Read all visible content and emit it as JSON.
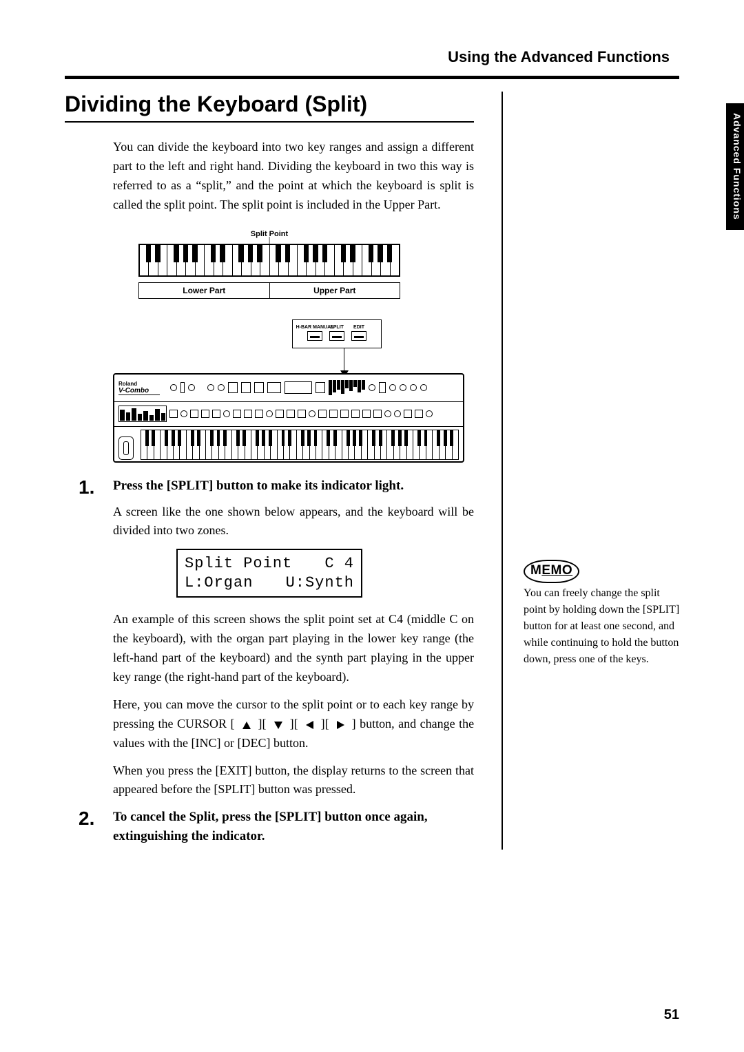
{
  "header": {
    "chapter": "Using the Advanced Functions"
  },
  "sideTab": "Advanced Functions",
  "section": {
    "title": "Dividing the Keyboard (Split)",
    "intro": "You can divide the keyboard into two key ranges and assign a different part to the left and right hand. Dividing the keyboard in two this way is referred to as a “split,” and the point at which the keyboard is split is called the split point. The split point is included in the Upper Part."
  },
  "diagram": {
    "splitLabel": "Split Point",
    "lower": "Lower Part",
    "upper": "Upper Part"
  },
  "callout": {
    "btn1": "H-BAR MANUAL",
    "btn2": "SPLIT",
    "btn3": "EDIT"
  },
  "synth": {
    "brand": "Roland",
    "model": "V-Combo"
  },
  "steps": {
    "one": {
      "num": "1.",
      "head": "Press the [SPLIT] button to make its indicator light.",
      "p1": "A screen like the one shown below appears, and the keyboard will be divided into two zones.",
      "lcd": {
        "l1a": "Split Point",
        "l1b": "C 4",
        "l2a": "L:Organ",
        "l2b": "U:Synth"
      },
      "p2": "An example of this screen shows the split point set at C4 (middle C on the keyboard), with the organ part playing in the lower key range (the left-hand part of the keyboard) and the synth part playing in the upper key range (the right-hand part of the keyboard).",
      "p3a": "Here, you can move the cursor to the split point or to each key range by pressing the CURSOR [",
      "p3b": "][",
      "p3c": "][",
      "p3d": "][",
      "p3e": "] button, and change the values with the [INC] or [DEC] button.",
      "p4": "When you press the [EXIT] button, the display returns to the screen that appeared before the [SPLIT] button was pressed."
    },
    "two": {
      "num": "2.",
      "head": "To cancel the Split, press the [SPLIT] button once again, extinguishing the indicator."
    }
  },
  "memo": {
    "label": "MEMO",
    "text": "You can freely change the split point by holding down the [SPLIT] button for at least one second, and while continuing to hold the button down, press one of the keys."
  },
  "pageNumber": "51"
}
